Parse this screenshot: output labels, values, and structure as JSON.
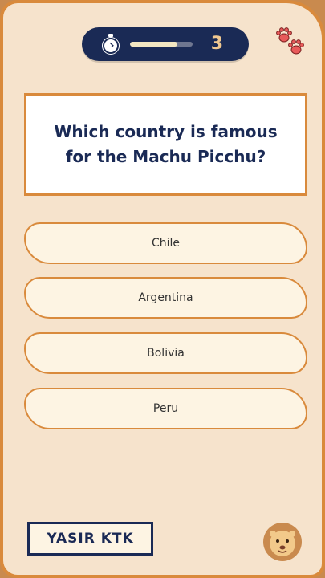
{
  "timer": {
    "icon": "stopwatch-icon",
    "progress": 0.75,
    "count": "3",
    "progress_color": "#f2e6c2",
    "bar_color": "#1a2a55"
  },
  "decor": {
    "top_icon": "paw-prints-icon",
    "bottom_icon": "lion-face-icon"
  },
  "question": {
    "text": "Which country is famous for the Machu Picchu?"
  },
  "answers": [
    {
      "label": "Chile"
    },
    {
      "label": "Argentina"
    },
    {
      "label": "Bolivia"
    },
    {
      "label": "Peru"
    }
  ],
  "footer": {
    "name": "YASIR KTK"
  },
  "colors": {
    "accent": "#d98a3c",
    "navy": "#1a2a55",
    "background": "#f6e3cc",
    "option_fill": "#fdf4e3"
  }
}
